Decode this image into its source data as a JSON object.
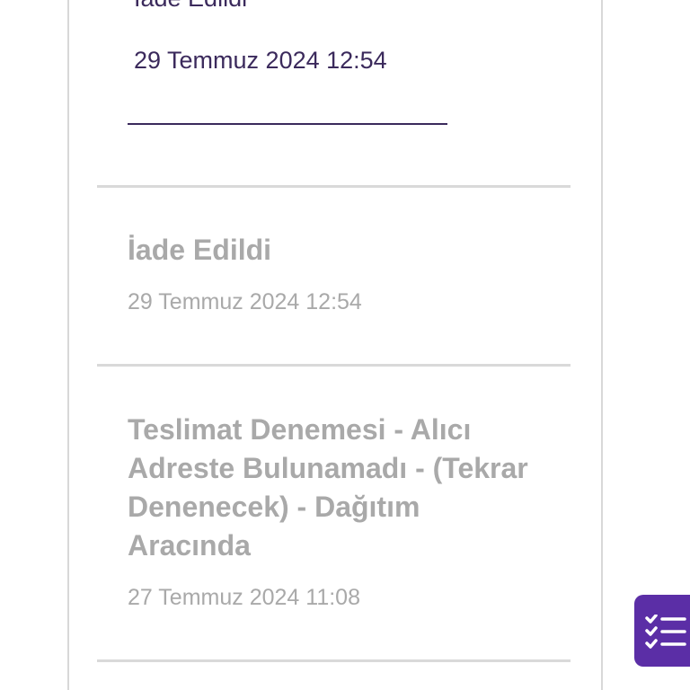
{
  "timeline": {
    "active_event": {
      "title": "İade Edildi",
      "date": "29 Temmuz 2024 12:54"
    },
    "events": [
      {
        "title": "İade Edildi",
        "date": "29 Temmuz 2024 12:54"
      },
      {
        "title": "Teslimat Denemesi - Alıcı Adreste Bulunamadı - (Tekrar Denenecek) - Dağıtım Aracında",
        "date": "27 Temmuz 2024 11:08"
      }
    ]
  },
  "fab": {
    "icon": "checklist-icon",
    "color": "#5b2ea6"
  },
  "colors": {
    "active_text": "#3b2a5c",
    "muted_text": "#a9a9a9",
    "divider": "#d9d9d9"
  }
}
